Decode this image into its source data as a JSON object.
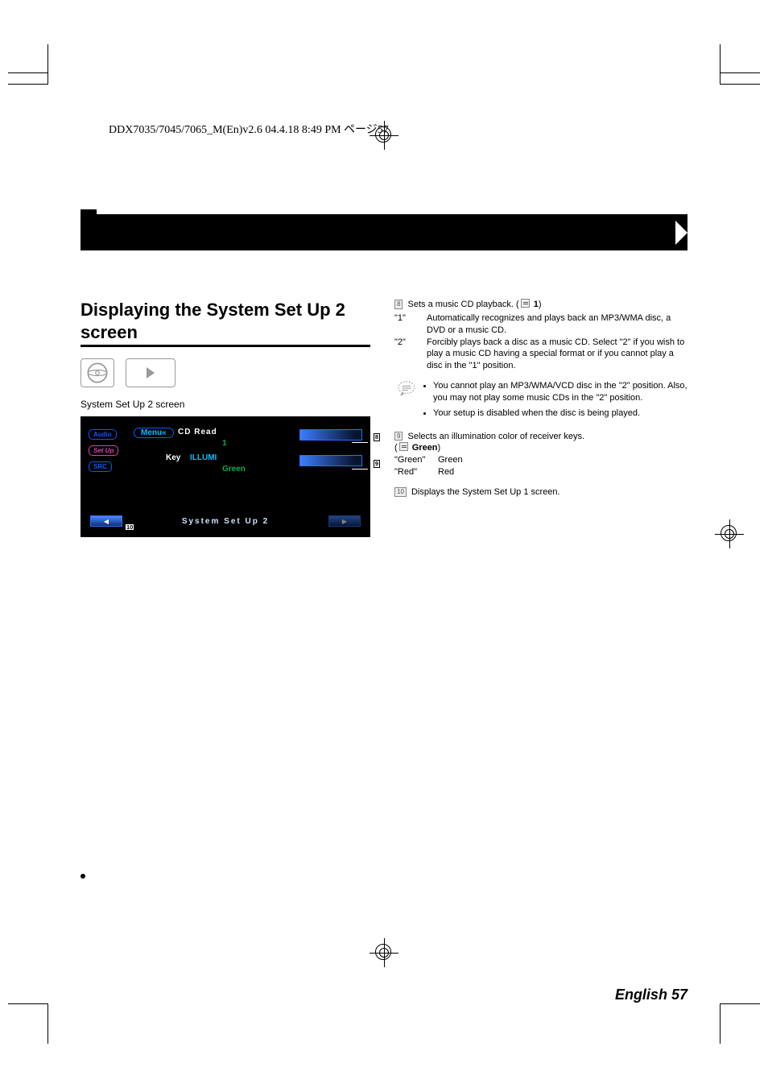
{
  "header_line": "DDX7035/7045/7065_M(En)v2.6  04.4.18  8:49 PM  ページ57",
  "section_title": "Displaying the System Set Up 2 screen",
  "caption": "System Set Up 2 screen",
  "screen": {
    "audio_btn": "Audio",
    "setup_btn": "Set Up",
    "src_btn": "SRC",
    "menu_tab": "Menu«",
    "cd_read_label": "CD Read",
    "cd_read_value": "1",
    "key_label": "Key",
    "illumi_label": "ILLUMI",
    "illumi_value": "Green",
    "bottom_title": "System Set Up 2"
  },
  "callouts": {
    "c8": "8",
    "c9": "9",
    "c10": "10"
  },
  "right": {
    "i8": {
      "lead": "Sets a music CD playback. (",
      "default": "1",
      "tail": ")",
      "opt1_key": "\"1\"",
      "opt1_txt": "Automatically recognizes and plays back an MP3/WMA disc, a DVD or a music CD.",
      "opt2_key": "\"2\"",
      "opt2_txt": "Forcibly plays back a disc as a music CD. Select \"2\" if you wish to play a music CD having a special format or if you cannot play a disc in the \"1\" position."
    },
    "note_bullets": [
      "You cannot play an MP3/WMA/VCD disc in the \"2\" position. Also, you may not play some music CDs in the \"2\" position.",
      "Your setup is disabled when the disc is being played."
    ],
    "i9": {
      "lead": "Selects an illumination color of receiver keys.",
      "default": "Green",
      "g_key": "\"Green\"",
      "g_val": "Green",
      "r_key": "\"Red\"",
      "r_val": "Red"
    },
    "i10": "Displays the System Set Up 1 screen."
  },
  "footer_label": "English",
  "footer_page": "57"
}
